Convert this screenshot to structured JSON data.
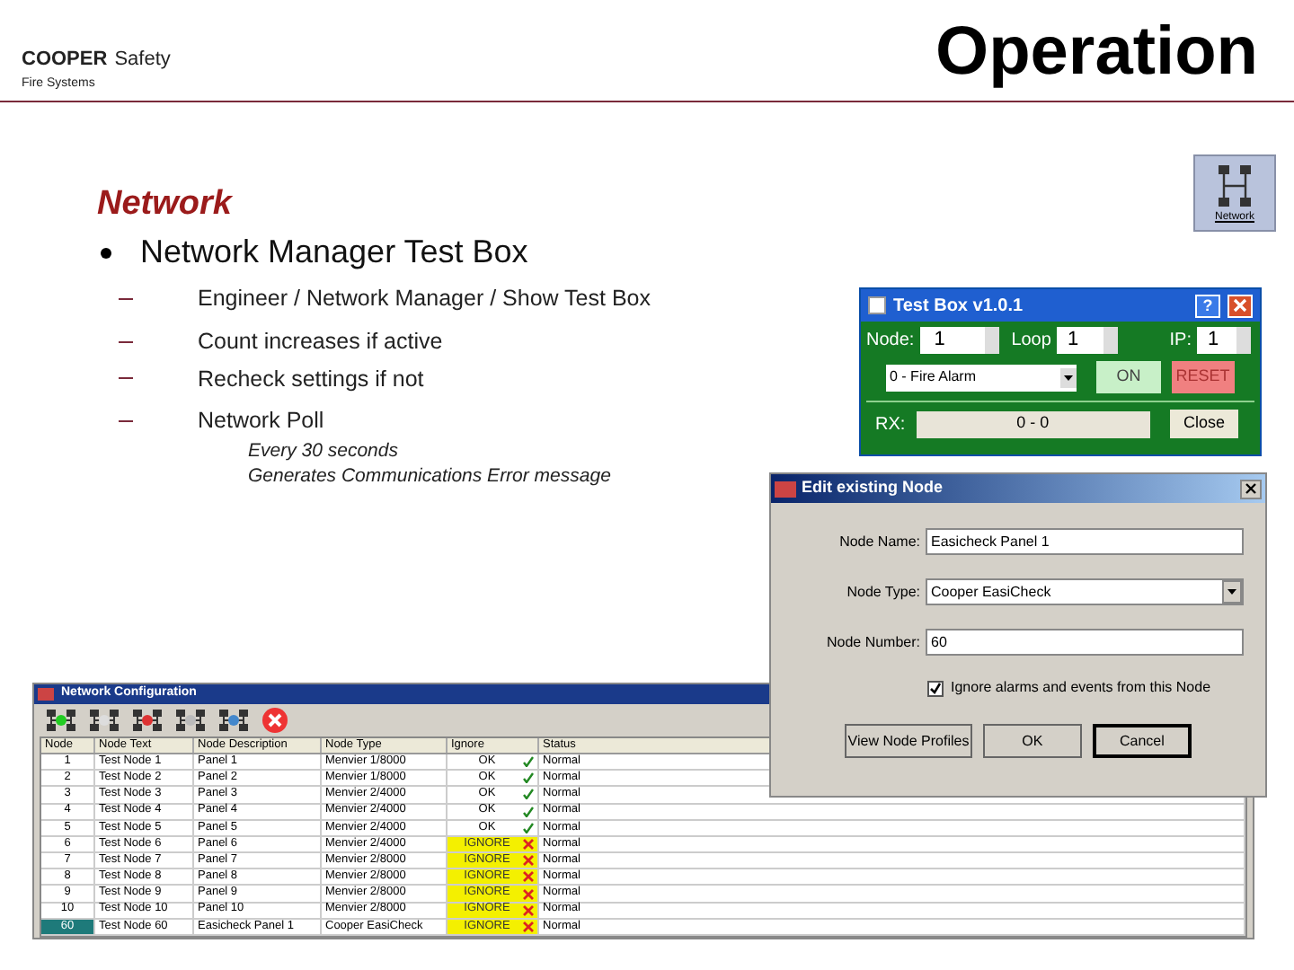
{
  "header": {
    "logo_brand": "COOPER",
    "logo_brand_suffix": "Safety",
    "logo_sub": "Fire Systems",
    "title": "Operation"
  },
  "section_title": "Network",
  "network_button": {
    "label": "Network"
  },
  "bullets": [
    {
      "text": "Network Manager Test Box",
      "children": [
        {
          "text": "Engineer / Network Manager / Show Test Box"
        },
        {
          "text": "Count increases if active"
        },
        {
          "text": "Recheck settings if not"
        },
        {
          "text": "Network Poll",
          "notes": [
            "Every 30 seconds",
            "Generates Communications Error message"
          ]
        }
      ]
    }
  ],
  "test_box": {
    "title": "Test Box v1.0.1",
    "help": "?",
    "node_label": "Node:",
    "node": "1",
    "loop_label": "Loop",
    "loop": "1",
    "ip_label": "IP:",
    "ip": "1",
    "event": "0 - Fire Alarm",
    "on_button": "ON",
    "reset_button": "RESET",
    "rx_label": "RX:",
    "rx": "0 - 0",
    "close_button": "Close"
  },
  "edit_node": {
    "title": "Edit existing Node",
    "fields": [
      {
        "label": "Node Name:",
        "value": "Easicheck Panel 1",
        "kind": "text"
      },
      {
        "label": "Node Type:",
        "value": "Cooper EasiCheck",
        "kind": "select"
      },
      {
        "label": "Node Number:",
        "value": "60",
        "kind": "text"
      }
    ],
    "checkbox": {
      "label": "Ignore alarms and events from this Node",
      "checked": true
    },
    "buttons": [
      {
        "label": "View Node Profiles",
        "default": false
      },
      {
        "label": "OK",
        "default": false
      },
      {
        "label": "Cancel",
        "default": true
      }
    ]
  },
  "network_config": {
    "title": "Network Configuration",
    "columns": [
      "Node",
      "Node Text",
      "Node Description",
      "Node Type",
      "Ignore",
      "Status"
    ],
    "rows": [
      {
        "cells": [
          "1",
          "Test Node 1",
          "Panel 1",
          "Menvier 1/8000",
          "OK",
          "Normal"
        ],
        "ignored": false,
        "selected": false
      },
      {
        "cells": [
          "2",
          "Test Node 2",
          "Panel 2",
          "Menvier 1/8000",
          "OK",
          "Normal"
        ],
        "ignored": false,
        "selected": false
      },
      {
        "cells": [
          "3",
          "Test Node 3",
          "Panel 3",
          "Menvier 2/4000",
          "OK",
          "Normal"
        ],
        "ignored": false,
        "selected": false
      },
      {
        "cells": [
          "4",
          "Test Node 4",
          "Panel 4",
          "Menvier 2/4000",
          "OK",
          "Normal"
        ],
        "ignored": false,
        "selected": false
      },
      {
        "cells": [
          "5",
          "Test Node 5",
          "Panel 5",
          "Menvier 2/4000",
          "OK",
          "Normal"
        ],
        "ignored": false,
        "selected": false
      },
      {
        "cells": [
          "6",
          "Test Node 6",
          "Panel 6",
          "Menvier 2/4000",
          "IGNORE",
          "Normal"
        ],
        "ignored": true,
        "selected": false
      },
      {
        "cells": [
          "7",
          "Test Node 7",
          "Panel 7",
          "Menvier 2/8000",
          "IGNORE",
          "Normal"
        ],
        "ignored": true,
        "selected": false
      },
      {
        "cells": [
          "8",
          "Test Node 8",
          "Panel 8",
          "Menvier 2/8000",
          "IGNORE",
          "Normal"
        ],
        "ignored": true,
        "selected": false
      },
      {
        "cells": [
          "9",
          "Test Node 9",
          "Panel 9",
          "Menvier 2/8000",
          "IGNORE",
          "Normal"
        ],
        "ignored": true,
        "selected": false
      },
      {
        "cells": [
          "10",
          "Test Node 10",
          "Panel 10",
          "Menvier 2/8000",
          "IGNORE",
          "Normal"
        ],
        "ignored": true,
        "selected": false
      },
      {
        "cells": [
          "60",
          "Test Node 60",
          "Easicheck Panel 1",
          "Cooper EasiCheck",
          "IGNORE",
          "Normal"
        ],
        "ignored": true,
        "selected": true
      }
    ]
  }
}
